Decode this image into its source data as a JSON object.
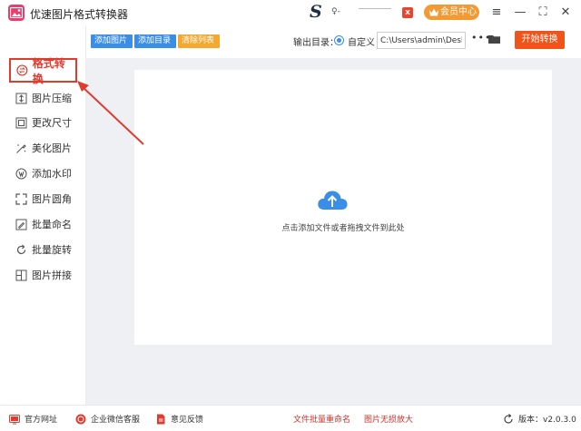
{
  "app": {
    "title": "优速图片格式转换器",
    "brand_letter": "S",
    "brand_text": "♀-",
    "close_badge": "x",
    "vip_label": "会员中心"
  },
  "window": {
    "menu_glyph": "≡",
    "minimize_glyph": "—",
    "maximize_glyph": "⛶",
    "close_glyph": "✕"
  },
  "sidebar": {
    "items": [
      {
        "label": "格式转换",
        "icon": "format-convert-icon",
        "active": true
      },
      {
        "label": "图片压缩",
        "icon": "compress-icon"
      },
      {
        "label": "更改尺寸",
        "icon": "resize-icon"
      },
      {
        "label": "美化图片",
        "icon": "beautify-icon"
      },
      {
        "label": "添加水印",
        "icon": "watermark-icon"
      },
      {
        "label": "图片圆角",
        "icon": "round-corner-icon"
      },
      {
        "label": "批量命名",
        "icon": "rename-icon"
      },
      {
        "label": "批量旋转",
        "icon": "rotate-icon"
      },
      {
        "label": "图片拼接",
        "icon": "stitch-icon"
      }
    ]
  },
  "toolbar": {
    "add_image": "添加图片",
    "add_folder": "添加目录",
    "clear_list": "清除列表",
    "output_label": "输出目录：",
    "custom_label": "自定义",
    "output_path": "C:\\Users\\admin\\Deskto",
    "more": "•••",
    "start": "开始转换"
  },
  "dropzone": {
    "hint": "点击添加文件或者拖拽文件到此处"
  },
  "footer": {
    "website": "官方网址",
    "wechat": "企业微信客服",
    "feedback": "意见反馈",
    "link_rename": "文件批量重命名",
    "link_enlarge": "图片无损放大",
    "version": "版本：v2.0.3.0"
  },
  "colors": {
    "accent_blue": "#3a8ee6",
    "accent_orange": "#f3a82f",
    "start_red": "#f0541b",
    "highlight_red": "#e03b2e"
  }
}
